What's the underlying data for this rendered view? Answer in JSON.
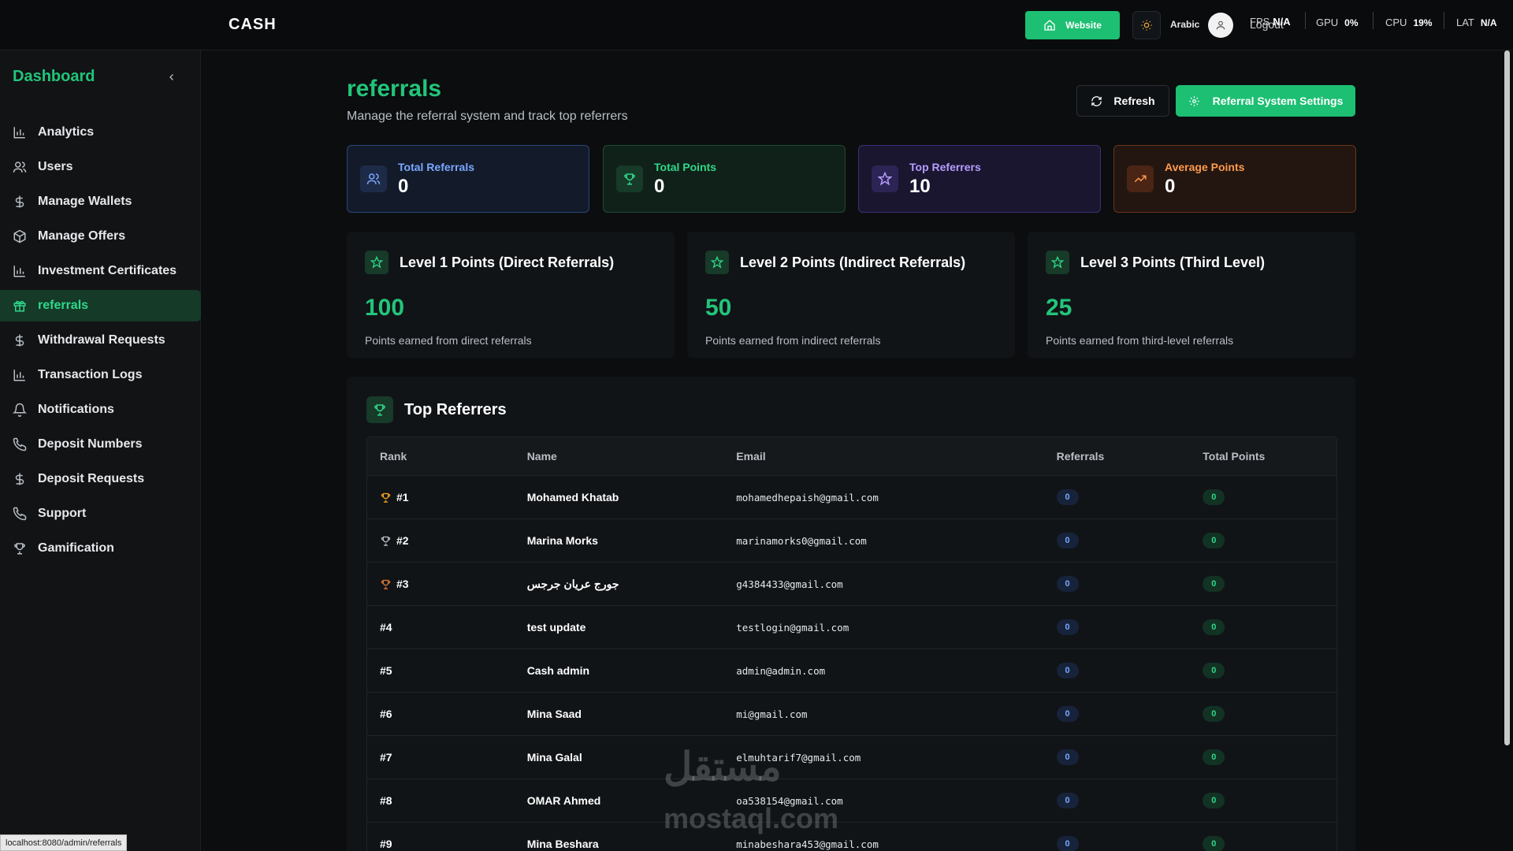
{
  "topbar": {
    "logo": "CASH",
    "website_label": "Website",
    "language": "Arabic",
    "logout": "Logout",
    "fps_label": "FPS",
    "fps_value": "N/A",
    "gpu_label": "GPU",
    "gpu_value": "0%",
    "cpu_label": "CPU",
    "cpu_value": "19%",
    "lat_label": "LAT",
    "lat_value": "N/A"
  },
  "sidebar": {
    "title": "Dashboard",
    "items": [
      {
        "label": "Analytics",
        "icon": "bar-chart-icon",
        "active": false
      },
      {
        "label": "Users",
        "icon": "users-icon",
        "active": false
      },
      {
        "label": "Manage Wallets",
        "icon": "dollar-icon",
        "active": false
      },
      {
        "label": "Manage Offers",
        "icon": "box-icon",
        "active": false
      },
      {
        "label": "Investment Certificates",
        "icon": "bar-chart-icon",
        "active": false
      },
      {
        "label": "referrals",
        "icon": "gift-icon",
        "active": true
      },
      {
        "label": "Withdrawal Requests",
        "icon": "dollar-icon",
        "active": false
      },
      {
        "label": "Transaction Logs",
        "icon": "bar-chart-icon",
        "active": false
      },
      {
        "label": "Notifications",
        "icon": "bell-icon",
        "active": false
      },
      {
        "label": "Deposit Numbers",
        "icon": "phone-icon",
        "active": false
      },
      {
        "label": "Deposit Requests",
        "icon": "dollar-icon",
        "active": false
      },
      {
        "label": "Support",
        "icon": "phone-icon",
        "active": false
      },
      {
        "label": "Gamification",
        "icon": "trophy-icon",
        "active": false
      }
    ]
  },
  "status_url": "localhost:8080/admin/referrals",
  "page": {
    "title": "referrals",
    "subtitle": "Manage the referral system and track top referrers",
    "refresh_label": "Refresh",
    "settings_label": "Referral System Settings"
  },
  "stats": [
    {
      "label": "Total Referrals",
      "value": "0"
    },
    {
      "label": "Total Points",
      "value": "0"
    },
    {
      "label": "Top Referrers",
      "value": "10"
    },
    {
      "label": "Average Points",
      "value": "0"
    }
  ],
  "levels": [
    {
      "title": "Level 1 Points (Direct Referrals)",
      "points": "100",
      "desc": "Points earned from direct referrals"
    },
    {
      "title": "Level 2 Points (Indirect Referrals)",
      "points": "50",
      "desc": "Points earned from indirect referrals"
    },
    {
      "title": "Level 3 Points (Third Level)",
      "points": "25",
      "desc": "Points earned from third-level referrals"
    }
  ],
  "top_referrers": {
    "title": "Top Referrers",
    "columns": [
      "Rank",
      "Name",
      "Email",
      "Referrals",
      "Total Points"
    ],
    "rows": [
      {
        "rank": "#1",
        "name": "Mohamed Khatab",
        "email": "mohamedhepaish@gmail.com",
        "referrals": "0",
        "points": "0",
        "trophy": "#f5a623"
      },
      {
        "rank": "#2",
        "name": "Marina Morks",
        "email": "marinamorks0@gmail.com",
        "referrals": "0",
        "points": "0",
        "trophy": "#b9bfc5"
      },
      {
        "rank": "#3",
        "name": "جورج عريان جرجس",
        "email": "g4384433@gmail.com",
        "referrals": "0",
        "points": "0",
        "trophy": "#e07a2e"
      },
      {
        "rank": "#4",
        "name": "test update",
        "email": "testlogin@gmail.com",
        "referrals": "0",
        "points": "0",
        "trophy": ""
      },
      {
        "rank": "#5",
        "name": "Cash admin",
        "email": "admin@admin.com",
        "referrals": "0",
        "points": "0",
        "trophy": ""
      },
      {
        "rank": "#6",
        "name": "Mina Saad",
        "email": "mi@gmail.com",
        "referrals": "0",
        "points": "0",
        "trophy": ""
      },
      {
        "rank": "#7",
        "name": "Mina Galal",
        "email": "elmuhtarif7@gmail.com",
        "referrals": "0",
        "points": "0",
        "trophy": ""
      },
      {
        "rank": "#8",
        "name": "OMAR Ahmed",
        "email": "oa538154@gmail.com",
        "referrals": "0",
        "points": "0",
        "trophy": ""
      },
      {
        "rank": "#9",
        "name": "Mina Beshara",
        "email": "minabeshara453@gmail.com",
        "referrals": "0",
        "points": "0",
        "trophy": ""
      }
    ]
  },
  "watermark": {
    "arabic": "مستقل",
    "latin": "mostaql.com"
  },
  "colors": {
    "accent": "#22c57a",
    "button": "#1dbf73",
    "background": "#0b0d0f"
  }
}
